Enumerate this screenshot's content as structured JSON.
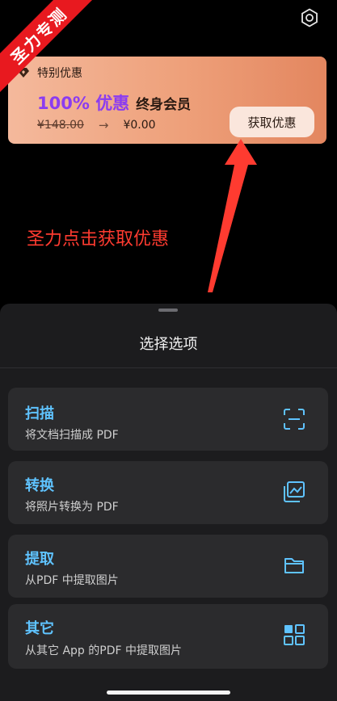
{
  "watermark": {
    "text": "圣力专测"
  },
  "header": {
    "settings_icon": "gear-icon"
  },
  "promo": {
    "heading": "特别优惠",
    "heading_icon": "gem-icon",
    "discount": "100% 优惠",
    "plan": "终身会员",
    "old_price": "¥148.00",
    "arrow": "→",
    "new_price": "¥0.00",
    "button_label": "获取优惠",
    "accent_color": "#8b3cf0"
  },
  "annotation": {
    "text": "圣力点击获取优惠",
    "color": "#ff3b30"
  },
  "sheet": {
    "title": "选择选项",
    "options": [
      {
        "title": "扫描",
        "desc": "将文档扫描成 PDF",
        "icon": "scan-icon"
      },
      {
        "title": "转换",
        "desc": "将照片转换为 PDF",
        "icon": "image-convert-icon"
      },
      {
        "title": "提取",
        "desc": "从PDF 中提取图片",
        "icon": "folder-icon"
      },
      {
        "title": "其它",
        "desc": "从其它 App 的PDF 中提取图片",
        "icon": "grid-icon"
      }
    ],
    "accent_color": "#5fc3ff"
  }
}
